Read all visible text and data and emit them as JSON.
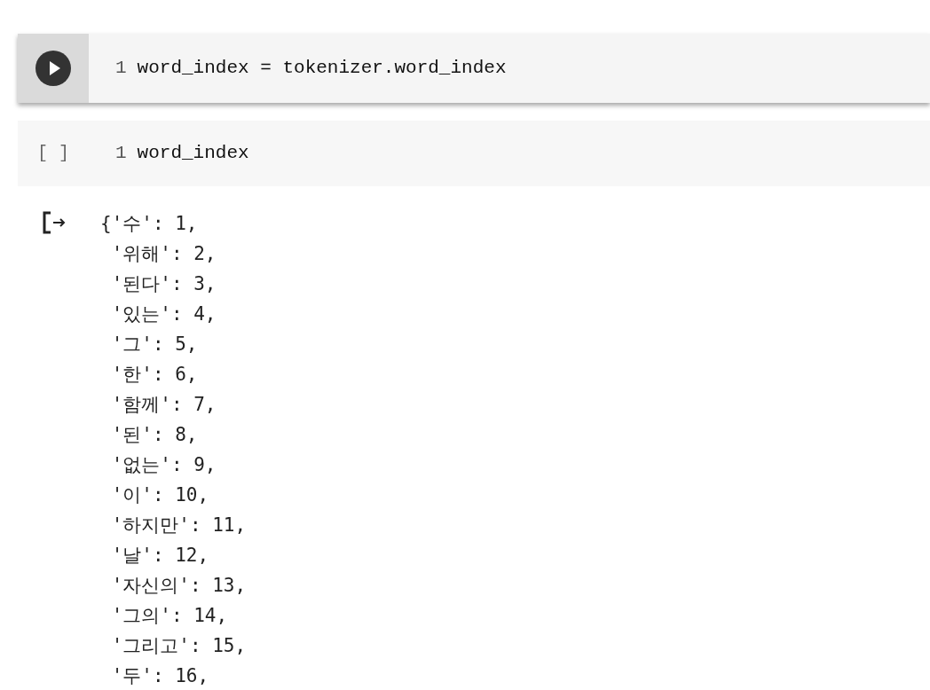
{
  "cells": [
    {
      "kind": "run",
      "selected": true,
      "line_number": "1",
      "code": "word_index = tokenizer.word_index"
    },
    {
      "kind": "idle",
      "selected": false,
      "prompt": "[ ]",
      "line_number": "1",
      "code": "word_index"
    }
  ],
  "output": {
    "lines": [
      "{'수': 1,",
      " '위해': 2,",
      " '된다': 3,",
      " '있는': 4,",
      " '그': 5,",
      " '한': 6,",
      " '함께': 7,",
      " '된': 8,",
      " '없는': 9,",
      " '이': 10,",
      " '하지만': 11,",
      " '날': 12,",
      " '자신의': 13,",
      " '그의': 14,",
      " '그리고': 15,",
      " '두': 16,"
    ]
  }
}
